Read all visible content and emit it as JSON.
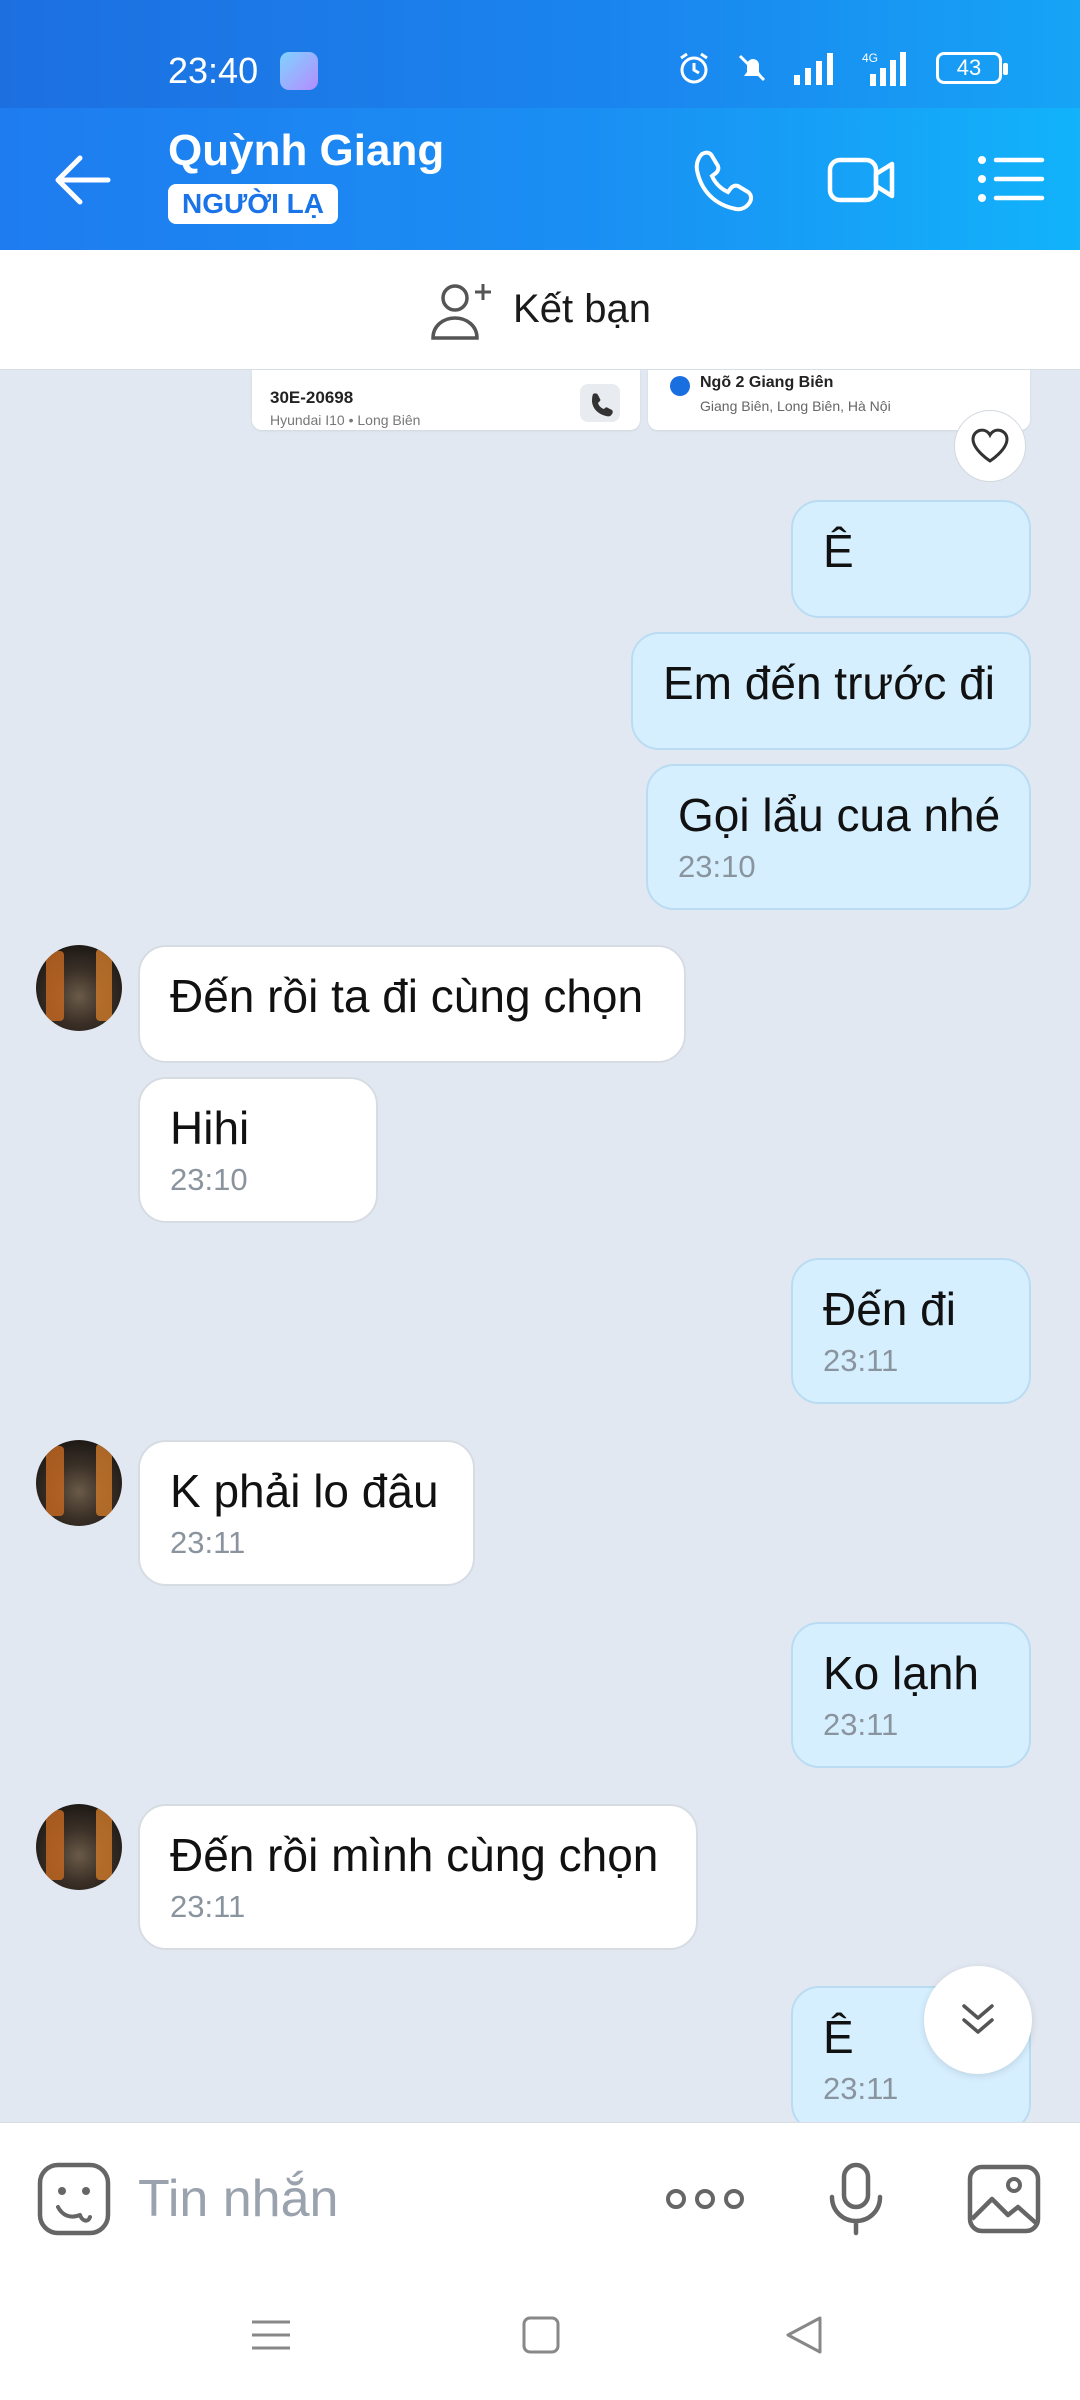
{
  "status_bar": {
    "time": "23:40",
    "battery": "43",
    "network": "4G"
  },
  "header": {
    "contact_name": "Quỳnh Giang",
    "badge": "NGƯỜI LẠ"
  },
  "add_friend": {
    "label": "Kết bạn"
  },
  "shared_card": {
    "plate": "30E-20698",
    "vehicle": "Hyundai I10 • Long Biên",
    "place_title": "Ngõ 2 Giang Biên",
    "place_address": "Giang Biên, Long Biên, Hà Nội"
  },
  "messages": [
    {
      "dir": "out",
      "text": "Ê",
      "time": ""
    },
    {
      "dir": "out",
      "text": "Em đến trước đi",
      "time": ""
    },
    {
      "dir": "out",
      "text": "Gọi lẩu cua nhé",
      "time": "23:10"
    },
    {
      "dir": "in",
      "text": "Đến rồi ta đi cùng chọn",
      "time": ""
    },
    {
      "dir": "in",
      "text": "Hihi",
      "time": "23:10"
    },
    {
      "dir": "out",
      "text": "Đến đi",
      "time": "23:11"
    },
    {
      "dir": "in",
      "text": "K phải lo đâu",
      "time": "23:11"
    },
    {
      "dir": "out",
      "text": "Ko lạnh",
      "time": "23:11"
    },
    {
      "dir": "in",
      "text": "Đến rồi mình cùng chọn",
      "time": "23:11"
    },
    {
      "dir": "out",
      "text": "Ê",
      "time": "23:11"
    }
  ],
  "composer": {
    "placeholder": "Tin nhắn"
  },
  "colors": {
    "header_start": "#1e7cf0",
    "header_end": "#12b3fb",
    "out_bubble": "#d6efff",
    "in_bubble": "#ffffff",
    "chat_bg": "#e2e8f1"
  },
  "icons": [
    "back-arrow-icon",
    "phone-icon",
    "video-call-icon",
    "menu-list-icon",
    "add-friend-icon",
    "heart-icon",
    "chevron-double-down-icon",
    "emoji-icon",
    "more-icon",
    "microphone-icon",
    "image-icon"
  ]
}
